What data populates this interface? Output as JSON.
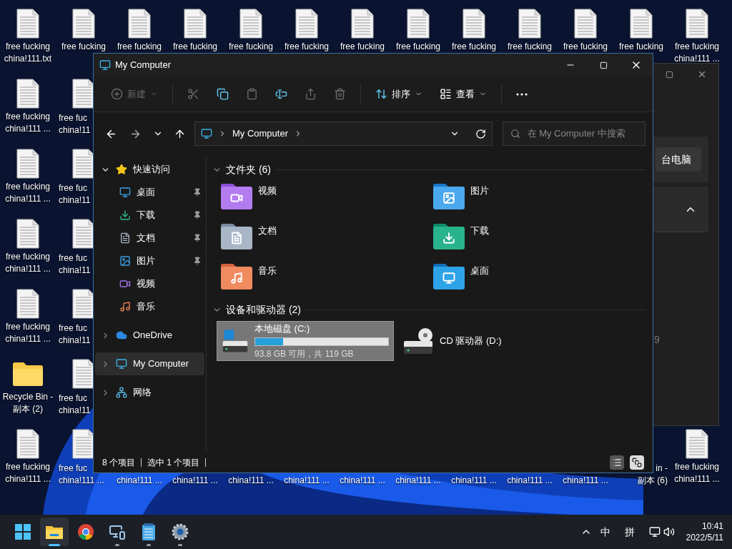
{
  "desktop": {
    "columns": [
      {
        "slots": [
          {
            "kind": "document",
            "lines": [
              "free fucking",
              "china!111.txt"
            ]
          },
          {
            "kind": "document",
            "lines": [
              "free fucking",
              "china!111 ..."
            ]
          },
          {
            "kind": "document",
            "lines": [
              "free fucking",
              "china!111 ..."
            ]
          },
          {
            "kind": "document",
            "lines": [
              "free fucking",
              "china!111 ..."
            ]
          },
          {
            "kind": "document",
            "lines": [
              "free fucking",
              "china!111 ..."
            ]
          },
          {
            "kind": "folder",
            "lines": [
              "Recycle Bin -",
              "副本 (2)"
            ]
          },
          {
            "kind": "document",
            "lines": [
              "free fucking",
              "china!111 ..."
            ]
          }
        ]
      },
      {
        "slots": [
          {
            "kind": "document",
            "lines": [
              "free fucking"
            ]
          },
          {
            "kind": "clipped-right",
            "lines": [
              "free fuc",
              "china!11"
            ]
          },
          {
            "kind": "clipped-right",
            "lines": [
              "free fuc",
              "china!11"
            ]
          },
          {
            "kind": "clipped-right",
            "lines": [
              "free fuc",
              "china!11"
            ]
          },
          {
            "kind": "clipped-right",
            "lines": [
              "free fuc",
              "china!11"
            ]
          },
          {
            "kind": "clipped-right",
            "lines": [
              "free fuc",
              "china!11"
            ]
          },
          {
            "kind": "clipped-right",
            "lines": [
              "free fuc",
              "china!111 ..."
            ]
          }
        ]
      },
      {
        "slots": [
          {
            "kind": "document",
            "lines": [
              "free fucking"
            ]
          },
          {
            "kind": "covered"
          },
          {
            "kind": "covered"
          },
          {
            "kind": "covered"
          },
          {
            "kind": "covered"
          },
          {
            "kind": "covered"
          },
          {
            "kind": "label-tail",
            "lines": [
              "china!111 ..."
            ]
          }
        ]
      },
      {
        "slots": [
          {
            "kind": "document",
            "lines": [
              "free fucking"
            ]
          },
          {
            "kind": "covered"
          },
          {
            "kind": "covered"
          },
          {
            "kind": "covered"
          },
          {
            "kind": "covered"
          },
          {
            "kind": "covered"
          },
          {
            "kind": "label-tail",
            "lines": [
              "china!111 ..."
            ]
          }
        ]
      },
      {
        "slots": [
          {
            "kind": "document",
            "lines": [
              "free fucking"
            ]
          },
          {
            "kind": "covered"
          },
          {
            "kind": "covered"
          },
          {
            "kind": "covered"
          },
          {
            "kind": "covered"
          },
          {
            "kind": "covered"
          },
          {
            "kind": "label-tail",
            "lines": [
              "china!111 ..."
            ]
          }
        ]
      },
      {
        "slots": [
          {
            "kind": "document",
            "lines": [
              "free fucking"
            ]
          },
          {
            "kind": "covered"
          },
          {
            "kind": "covered"
          },
          {
            "kind": "covered"
          },
          {
            "kind": "covered"
          },
          {
            "kind": "covered"
          },
          {
            "kind": "label-tail",
            "lines": [
              "china!111 ..."
            ]
          }
        ]
      },
      {
        "slots": [
          {
            "kind": "document",
            "lines": [
              "free fucking"
            ]
          },
          {
            "kind": "covered"
          },
          {
            "kind": "covered"
          },
          {
            "kind": "covered"
          },
          {
            "kind": "covered"
          },
          {
            "kind": "covered"
          },
          {
            "kind": "label-tail",
            "lines": [
              "china!111 ..."
            ]
          }
        ]
      },
      {
        "slots": [
          {
            "kind": "document",
            "lines": [
              "free fucking"
            ]
          },
          {
            "kind": "covered"
          },
          {
            "kind": "covered"
          },
          {
            "kind": "covered"
          },
          {
            "kind": "covered"
          },
          {
            "kind": "covered"
          },
          {
            "kind": "label-tail",
            "lines": [
              "china!111 ..."
            ]
          }
        ]
      },
      {
        "slots": [
          {
            "kind": "document",
            "lines": [
              "free fucking"
            ]
          },
          {
            "kind": "covered"
          },
          {
            "kind": "covered"
          },
          {
            "kind": "covered"
          },
          {
            "kind": "covered"
          },
          {
            "kind": "covered"
          },
          {
            "kind": "label-tail",
            "lines": [
              "china!111 ..."
            ]
          }
        ]
      },
      {
        "slots": [
          {
            "kind": "document",
            "lines": [
              "free fucking"
            ]
          },
          {
            "kind": "covered"
          },
          {
            "kind": "covered"
          },
          {
            "kind": "covered"
          },
          {
            "kind": "covered"
          },
          {
            "kind": "covered"
          },
          {
            "kind": "label-tail",
            "lines": [
              "china!111 ..."
            ]
          }
        ]
      },
      {
        "slots": [
          {
            "kind": "document",
            "lines": [
              "free fucking"
            ]
          },
          {
            "kind": "covered"
          },
          {
            "kind": "covered"
          },
          {
            "kind": "covered"
          },
          {
            "kind": "covered"
          },
          {
            "kind": "covered"
          },
          {
            "kind": "label-tail",
            "lines": [
              "china!111 ..."
            ]
          }
        ]
      },
      {
        "slots": [
          {
            "kind": "document",
            "lines": [
              "free fucking"
            ]
          },
          {
            "kind": "covered"
          },
          {
            "kind": "covered"
          },
          {
            "kind": "covered"
          },
          {
            "kind": "covered"
          },
          {
            "kind": "covered"
          },
          {
            "kind": "clipped-left",
            "lines": [
              "in -",
              "副本 (6)"
            ]
          }
        ]
      },
      {
        "slots": [
          {
            "kind": "document",
            "lines": [
              "free fucking",
              "china!111 ..."
            ]
          },
          {
            "kind": "covered"
          },
          {
            "kind": "covered"
          },
          {
            "kind": "covered"
          },
          {
            "kind": "covered"
          },
          {
            "kind": "covered"
          },
          {
            "kind": "document",
            "lines": [
              "free fucking",
              "china!111 ..."
            ]
          }
        ]
      }
    ]
  },
  "back_window": {
    "button": "台电脑",
    "value": "9"
  },
  "window": {
    "title": "My Computer",
    "toolbar": [
      {
        "kind": "new",
        "label": "新建",
        "disabled": true
      },
      {
        "kind": "cut",
        "disabled": true
      },
      {
        "kind": "copy",
        "disabled": false
      },
      {
        "kind": "paste",
        "disabled": true
      },
      {
        "kind": "rename",
        "disabled": false
      },
      {
        "kind": "share",
        "disabled": true
      },
      {
        "kind": "delete",
        "disabled": true
      },
      {
        "kind": "sort",
        "label": "排序",
        "disabled": false
      },
      {
        "kind": "view",
        "label": "查看",
        "disabled": false
      },
      {
        "kind": "more",
        "disabled": false
      }
    ],
    "address": {
      "path": "My Computer"
    },
    "search": {
      "placeholder": "在 My Computer 中搜索"
    },
    "sidebar": {
      "items": [
        {
          "kind": "quick",
          "label": "快速访问",
          "expanded": true,
          "selected": false,
          "children": [
            {
              "kind": "desktop",
              "label": "桌面",
              "pinned": true
            },
            {
              "kind": "downloads",
              "label": "下载",
              "pinned": true
            },
            {
              "kind": "documents",
              "label": "文档",
              "pinned": true
            },
            {
              "kind": "pictures",
              "label": "图片",
              "pinned": true
            },
            {
              "kind": "videos",
              "label": "视频",
              "pinned": false
            },
            {
              "kind": "music",
              "label": "音乐",
              "pinned": false
            }
          ]
        },
        {
          "kind": "onedrive",
          "label": "OneDrive",
          "expanded": false,
          "selected": false
        },
        {
          "kind": "computer",
          "label": "My Computer",
          "expanded": false,
          "selected": true
        },
        {
          "kind": "network",
          "label": "网络",
          "expanded": false,
          "selected": false
        }
      ]
    },
    "folders": {
      "title": "文件夹 (6)",
      "items": [
        {
          "kind": "videos",
          "name": "视频"
        },
        {
          "kind": "pictures",
          "name": "图片"
        },
        {
          "kind": "documents",
          "name": "文档"
        },
        {
          "kind": "downloads",
          "name": "下载"
        },
        {
          "kind": "music",
          "name": "音乐"
        },
        {
          "kind": "desktop",
          "name": "桌面"
        }
      ]
    },
    "drives": {
      "title": "设备和驱动器 (2)",
      "items": [
        {
          "kind": "local",
          "name": "本地磁盘 (C:)",
          "selected": true,
          "level": 0.21,
          "detail": "93.8 GB 可用，共 119 GB"
        },
        {
          "kind": "cd",
          "name": "CD 驱动器 (D:)",
          "selected": false
        }
      ]
    },
    "status_bar": {
      "count": "8 个项目",
      "selection": "选中 1 个项目",
      "views": [
        {
          "kind": "details",
          "selected": false
        },
        {
          "kind": "large",
          "selected": true
        }
      ]
    }
  },
  "taskbar": {
    "apps": [
      {
        "kind": "start",
        "active": false,
        "running": false
      },
      {
        "kind": "explorer",
        "active": true,
        "running": true
      },
      {
        "kind": "browser",
        "active": false,
        "running": false
      },
      {
        "kind": "remote",
        "active": false,
        "running": true
      },
      {
        "kind": "notepad",
        "active": false,
        "running": true
      },
      {
        "kind": "settings",
        "active": false,
        "running": true
      }
    ],
    "tray": {
      "ime_mode": "中",
      "ime": "拼",
      "time": "10:41",
      "date": "2022/5/11"
    }
  }
}
